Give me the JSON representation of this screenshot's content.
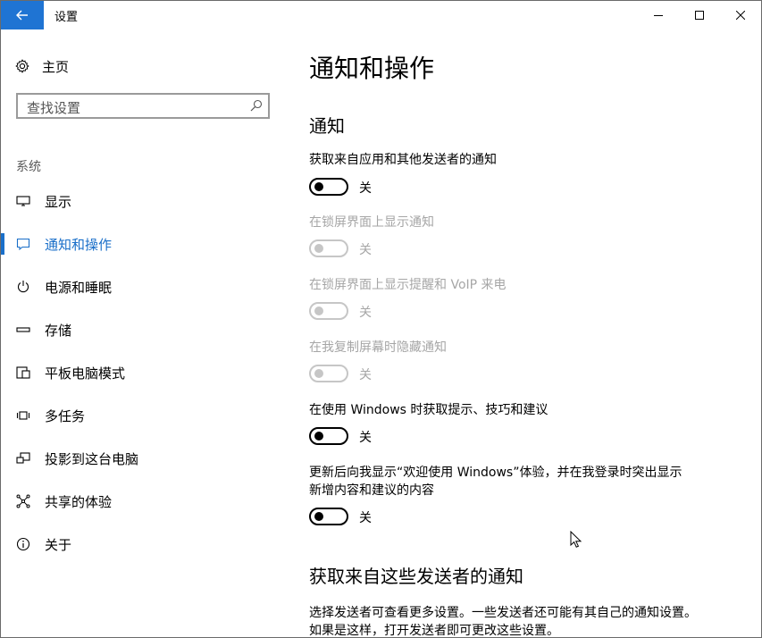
{
  "window": {
    "title": "设置"
  },
  "sidebar": {
    "home_label": "主页",
    "search_placeholder": "查找设置",
    "section_label": "系统",
    "items": [
      {
        "id": "display",
        "label": "显示",
        "icon": "monitor-icon"
      },
      {
        "id": "notifications",
        "label": "通知和操作",
        "icon": "message-icon",
        "active": true
      },
      {
        "id": "power",
        "label": "电源和睡眠",
        "icon": "power-icon"
      },
      {
        "id": "storage",
        "label": "存储",
        "icon": "storage-icon"
      },
      {
        "id": "tablet",
        "label": "平板电脑模式",
        "icon": "tablet-icon"
      },
      {
        "id": "multitasking",
        "label": "多任务",
        "icon": "multitask-icon"
      },
      {
        "id": "project",
        "label": "投影到这台电脑",
        "icon": "project-icon"
      },
      {
        "id": "shared",
        "label": "共享的体验",
        "icon": "share-icon"
      },
      {
        "id": "about",
        "label": "关于",
        "icon": "info-icon"
      }
    ]
  },
  "main": {
    "page_title": "通知和操作",
    "section_notifications": "通知",
    "settings": [
      {
        "label": "获取来自应用和其他发送者的通知",
        "state": "关",
        "disabled": false
      },
      {
        "label": "在锁屏界面上显示通知",
        "state": "关",
        "disabled": true
      },
      {
        "label": "在锁屏界面上显示提醒和 VoIP 来电",
        "state": "关",
        "disabled": true
      },
      {
        "label": "在我复制屏幕时隐藏通知",
        "state": "关",
        "disabled": true
      },
      {
        "label": "在使用 Windows 时获取提示、技巧和建议",
        "state": "关",
        "disabled": false
      },
      {
        "label_line1": "更新后向我显示“欢迎使用 Windows”体验，并在我登录时突出显示",
        "label_line2": "新增内容和建议的内容",
        "state": "关",
        "disabled": false
      }
    ],
    "section_senders": "获取来自这些发送者的通知",
    "senders_desc_line1": "选择发送者可查看更多设置。一些发送者还可能有其自己的通知设置。",
    "senders_desc_line2": "如果是这样，打开发送者即可更改这些设置。"
  },
  "colors": {
    "accent": "#1a6fc9",
    "back_button": "#1f74d3",
    "disabled_text": "#a6a6a6"
  }
}
